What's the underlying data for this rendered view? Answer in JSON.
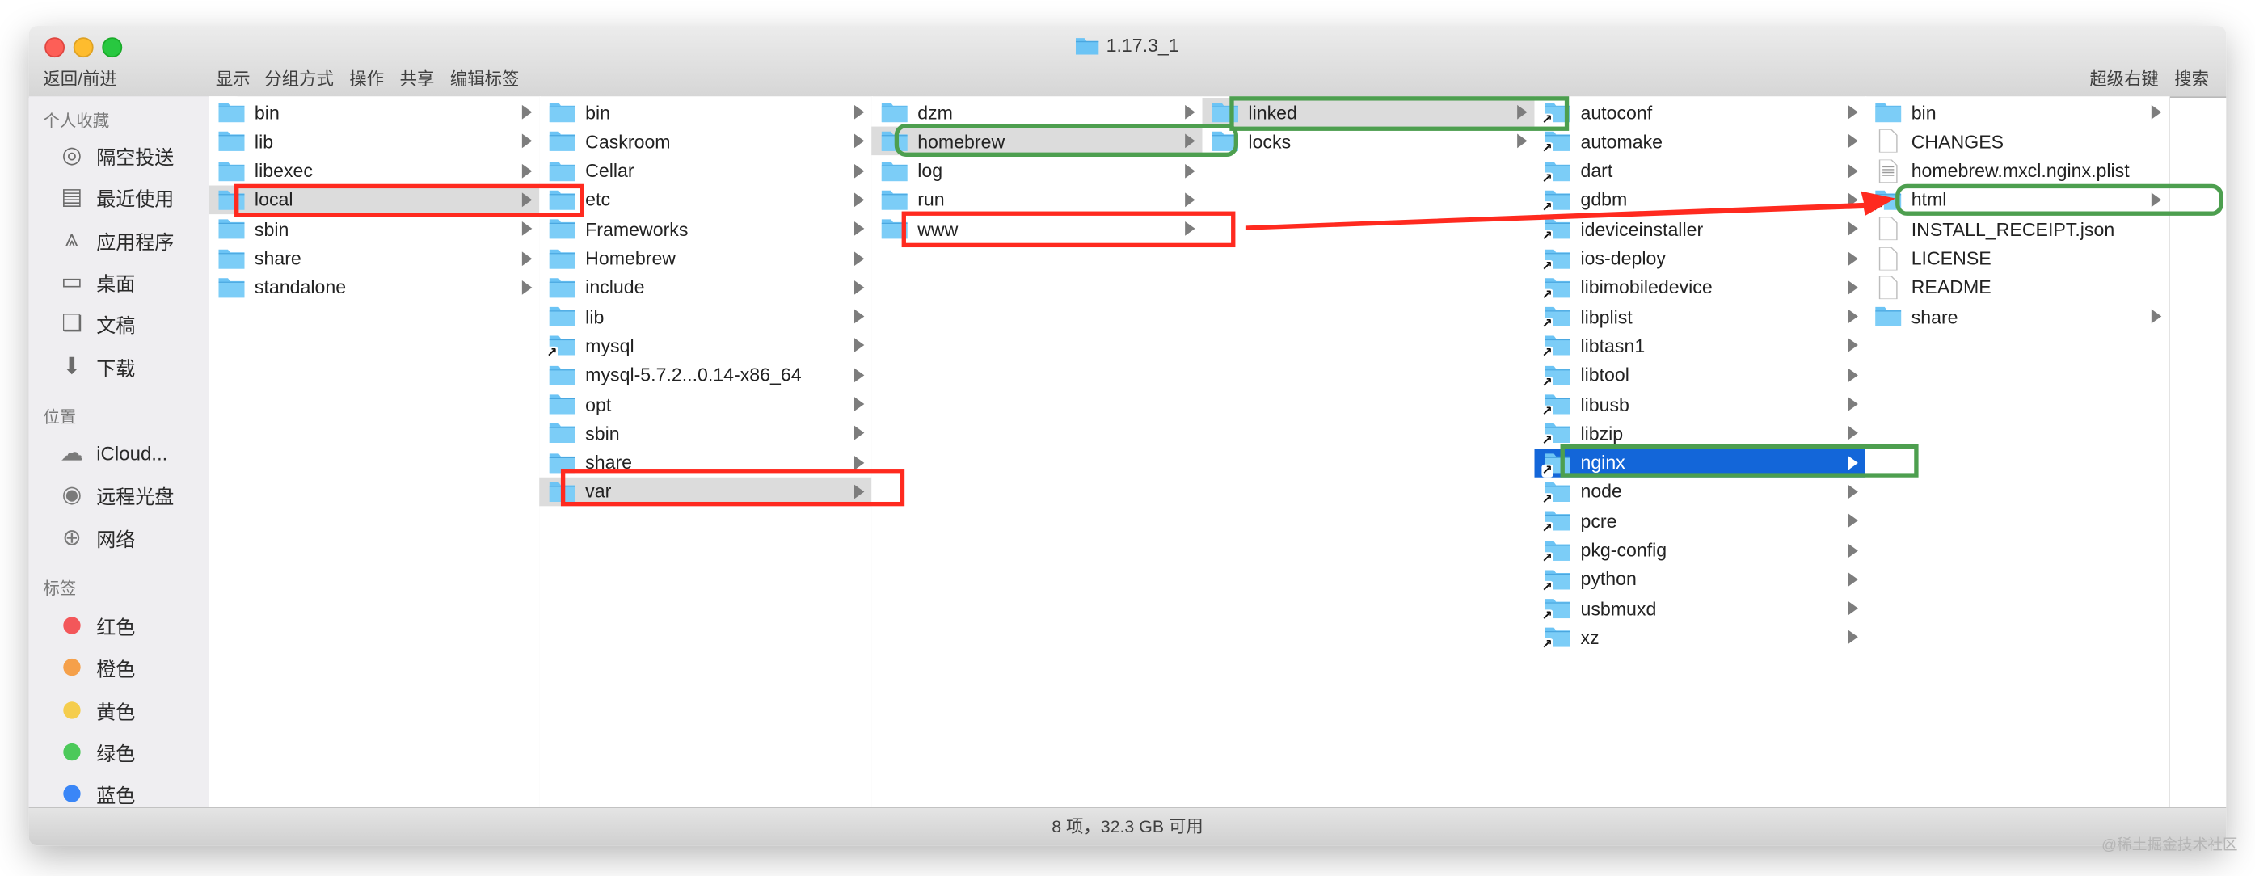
{
  "window": {
    "title": "1.17.3_1"
  },
  "toolbar": {
    "back_forward": "返回/前进",
    "view": "显示",
    "group": "分组方式",
    "action": "操作",
    "share": "共享",
    "edit_tags": "编辑标签",
    "super_right": "超级右键",
    "search": "搜索"
  },
  "sidebar": {
    "favorites_header": "个人收藏",
    "favorites": [
      {
        "label": "隔空投送",
        "icon": "airdrop-icon"
      },
      {
        "label": "最近使用",
        "icon": "recents-icon"
      },
      {
        "label": "应用程序",
        "icon": "applications-icon"
      },
      {
        "label": "桌面",
        "icon": "desktop-icon"
      },
      {
        "label": "文稿",
        "icon": "documents-icon"
      },
      {
        "label": "下载",
        "icon": "downloads-icon"
      }
    ],
    "locations_header": "位置",
    "locations": [
      {
        "label": "iCloud...",
        "icon": "cloud-icon"
      },
      {
        "label": "远程光盘",
        "icon": "disc-icon"
      },
      {
        "label": "网络",
        "icon": "network-icon"
      }
    ],
    "tags_header": "标签",
    "tags": [
      {
        "label": "红色",
        "color": "#f3575a"
      },
      {
        "label": "橙色",
        "color": "#f5a04a"
      },
      {
        "label": "黄色",
        "color": "#f5cd4d"
      },
      {
        "label": "绿色",
        "color": "#4cc95a"
      },
      {
        "label": "蓝色",
        "color": "#3a86f7"
      }
    ]
  },
  "columns": [
    {
      "selected": 3,
      "items": [
        {
          "name": "bin"
        },
        {
          "name": "lib"
        },
        {
          "name": "libexec"
        },
        {
          "name": "local"
        },
        {
          "name": "sbin"
        },
        {
          "name": "share"
        },
        {
          "name": "standalone"
        }
      ]
    },
    {
      "selected": 13,
      "items": [
        {
          "name": "bin"
        },
        {
          "name": "Caskroom"
        },
        {
          "name": "Cellar"
        },
        {
          "name": "etc"
        },
        {
          "name": "Frameworks"
        },
        {
          "name": "Homebrew"
        },
        {
          "name": "include"
        },
        {
          "name": "lib"
        },
        {
          "name": "mysql",
          "alias": true
        },
        {
          "name": "mysql-5.7.2...0.14-x86_64"
        },
        {
          "name": "opt"
        },
        {
          "name": "sbin"
        },
        {
          "name": "share"
        },
        {
          "name": "var"
        }
      ]
    },
    {
      "selected": 1,
      "items": [
        {
          "name": "dzm"
        },
        {
          "name": "homebrew"
        },
        {
          "name": "log"
        },
        {
          "name": "run"
        },
        {
          "name": "www"
        }
      ]
    },
    {
      "selected": 0,
      "items": [
        {
          "name": "linked"
        },
        {
          "name": "locks"
        }
      ]
    },
    {
      "selected": 12,
      "active": true,
      "items": [
        {
          "name": "autoconf",
          "alias": true
        },
        {
          "name": "automake",
          "alias": true
        },
        {
          "name": "dart",
          "alias": true
        },
        {
          "name": "gdbm",
          "alias": true
        },
        {
          "name": "ideviceinstaller",
          "alias": true
        },
        {
          "name": "ios-deploy",
          "alias": true
        },
        {
          "name": "libimobiledevice",
          "alias": true
        },
        {
          "name": "libplist",
          "alias": true
        },
        {
          "name": "libtasn1",
          "alias": true
        },
        {
          "name": "libtool",
          "alias": true
        },
        {
          "name": "libusb",
          "alias": true
        },
        {
          "name": "libzip",
          "alias": true
        },
        {
          "name": "nginx",
          "alias": true
        },
        {
          "name": "node",
          "alias": true
        },
        {
          "name": "pcre",
          "alias": true
        },
        {
          "name": "pkg-config",
          "alias": true
        },
        {
          "name": "python",
          "alias": true
        },
        {
          "name": "usbmuxd",
          "alias": true
        },
        {
          "name": "xz",
          "alias": true
        }
      ]
    },
    {
      "selected": -1,
      "items": [
        {
          "name": "bin"
        },
        {
          "name": "CHANGES",
          "type": "file"
        },
        {
          "name": "homebrew.mxcl.nginx.plist",
          "type": "plist"
        },
        {
          "name": "html",
          "alias": true
        },
        {
          "name": "INSTALL_RECEIPT.json",
          "type": "file"
        },
        {
          "name": "LICENSE",
          "type": "file"
        },
        {
          "name": "README",
          "type": "file"
        },
        {
          "name": "share"
        }
      ]
    }
  ],
  "status": {
    "text": "8 项，32.3 GB 可用"
  },
  "watermark": "@稀土掘金技术社区",
  "colors": {
    "selection_blue": "#1366d9",
    "annotation_red": "#ff2a1f",
    "annotation_green": "#4d9f4f",
    "folder_blue": "#6cc4f5"
  }
}
